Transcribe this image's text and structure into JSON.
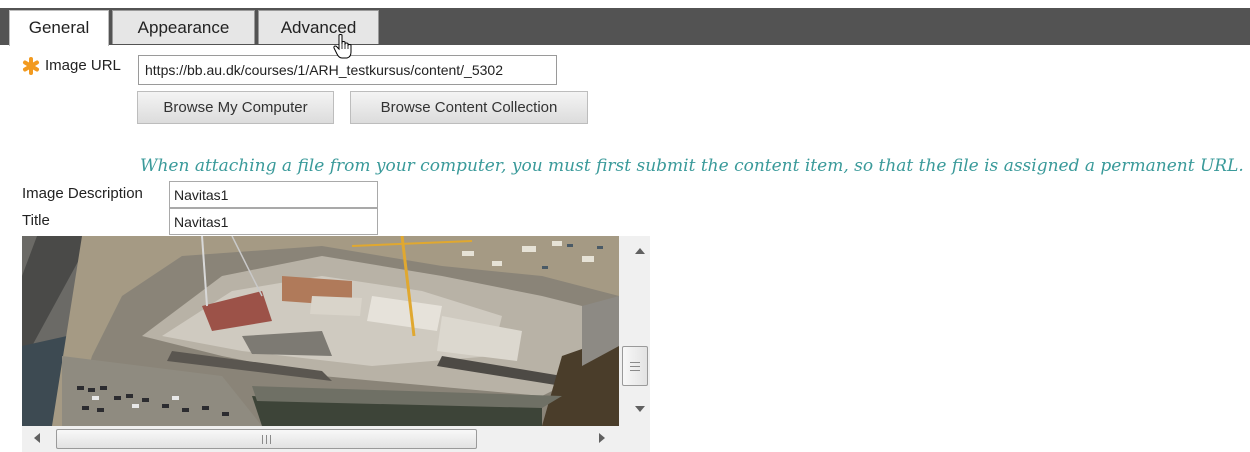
{
  "tabs": [
    {
      "label": "General",
      "active": true
    },
    {
      "label": "Appearance",
      "active": false
    },
    {
      "label": "Advanced",
      "active": false
    }
  ],
  "form": {
    "image_url_label": "Image URL",
    "image_url_value": "https://bb.au.dk/courses/1/ARH_testkursus/content/_5302",
    "browse_computer_label": "Browse My Computer",
    "browse_collection_label": "Browse Content Collection",
    "notice": "When attaching a file from your computer, you must first submit the content item, so that the file is assigned a permanent URL.",
    "image_description_label": "Image Description",
    "image_description_value": "Navitas1",
    "title_label": "Title",
    "title_value": "Navitas1"
  },
  "colors": {
    "tabbar_bg": "#535353",
    "required_star": "#f29a1f",
    "notice_text": "#3a9a9a"
  },
  "icons": {
    "required": "asterisk-icon",
    "cursor": "hand-pointer-icon"
  }
}
